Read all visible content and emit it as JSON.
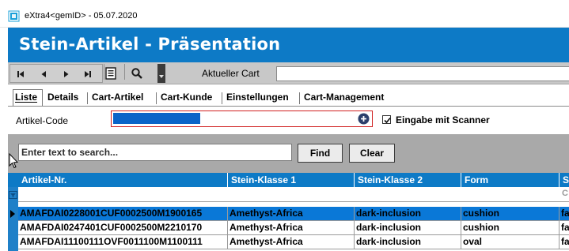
{
  "window": {
    "title": "eXtra4<gemID>  -  05.07.2020"
  },
  "header": {
    "title": "Stein-Artikel - Präsentation"
  },
  "toolbar": {
    "nav_icons": [
      "first-icon",
      "previous-icon",
      "next-icon",
      "last-icon"
    ],
    "list_icon": "list-icon",
    "search_icon": "search-icon",
    "cart_label": "Aktueller Cart",
    "cart_value": ""
  },
  "tabs": {
    "liste": "Liste",
    "details": "Details",
    "cart_artikel": "Cart-Artikel",
    "cart_kunde": "Cart-Kunde",
    "einstellungen": "Einstellungen",
    "cart_management": "Cart-Management",
    "active": "Liste"
  },
  "form": {
    "code_label": "Artikel-Code",
    "code_value": "",
    "scanner_label": "Eingabe mit Scanner",
    "scanner_checked": true
  },
  "search": {
    "placeholder": "Enter text to search...",
    "find_label": "Find",
    "clear_label": "Clear"
  },
  "grid": {
    "columns": [
      "Artikel-Nr.",
      "Stein-Klasse 1",
      "Stein-Klasse 2",
      "Form",
      "S"
    ],
    "filter_hint": "C",
    "rows": [
      {
        "artikel": "AMAFDAI0228001CUF0002500M1900165",
        "klasse1": "Amethyst-Africa",
        "klasse2": "dark-inclusion",
        "form": "cushion",
        "s": "fa",
        "selected": true
      },
      {
        "artikel": "AMAFDAI0247401CUF0002500M2210170",
        "klasse1": "Amethyst-Africa",
        "klasse2": "dark-inclusion",
        "form": "cushion",
        "s": "fa",
        "selected": false
      },
      {
        "artikel": "AMAFDAI11100111OVF0011100M1100111",
        "klasse1": "Amethyst-Africa",
        "klasse2": "dark-inclusion",
        "form": "oval",
        "s": "fa",
        "selected": false
      }
    ]
  },
  "colors": {
    "header_blue": "#0d7ac6",
    "selection_blue": "#0a78d7",
    "toolbar_gray": "#c8c8c8",
    "search_gray": "#a9a9a9"
  }
}
